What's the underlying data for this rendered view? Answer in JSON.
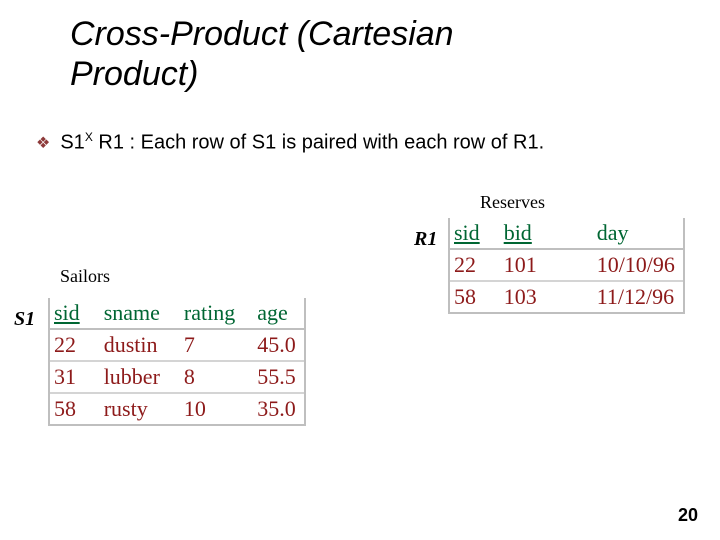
{
  "title_l1": "Cross-Product (Cartesian",
  "title_l2": "Product)",
  "bullet": {
    "s1": "S1",
    "x": "X",
    "r1": " R1  : Each row of S1 is paired with each row of R1."
  },
  "labels": {
    "reserves": "Reserves",
    "r1": "R1",
    "sailors": "Sailors",
    "s1": "S1"
  },
  "r1": {
    "h_sid": "sid",
    "h_bid": "bid",
    "h_day": "day",
    "rows": [
      {
        "sid": "22",
        "bid": "101",
        "day": "10/10/96"
      },
      {
        "sid": "58",
        "bid": "103",
        "day": "11/12/96"
      }
    ]
  },
  "s1": {
    "h_sid": "sid",
    "h_sname": "sname",
    "h_rating": "rating",
    "h_age": "age",
    "rows": [
      {
        "sid": "22",
        "sname": "dustin",
        "rating": "7",
        "age": "45.0"
      },
      {
        "sid": "31",
        "sname": "lubber",
        "rating": "8",
        "age": "55.5"
      },
      {
        "sid": "58",
        "sname": "rusty",
        "rating": "10",
        "age": "35.0"
      }
    ]
  },
  "page": "20"
}
